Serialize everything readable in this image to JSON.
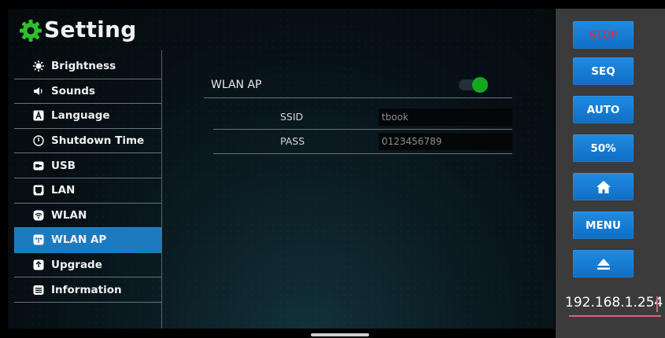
{
  "header": {
    "title": "Setting",
    "icon": "gear-icon",
    "icon_color": "#2fbf2f"
  },
  "sidebar": {
    "items": [
      {
        "label": "Brightness",
        "icon": "brightness-icon"
      },
      {
        "label": "Sounds",
        "icon": "speaker-icon"
      },
      {
        "label": "Language",
        "icon": "language-icon"
      },
      {
        "label": "Shutdown Time",
        "icon": "power-icon"
      },
      {
        "label": "USB",
        "icon": "usb-icon"
      },
      {
        "label": "LAN",
        "icon": "lan-icon"
      },
      {
        "label": "WLAN",
        "icon": "wifi-icon"
      },
      {
        "label": "WLAN AP",
        "icon": "hotspot-icon",
        "active": true
      },
      {
        "label": "Upgrade",
        "icon": "upgrade-icon"
      },
      {
        "label": "Information",
        "icon": "information-icon"
      }
    ],
    "active_color": "#1c7bbf"
  },
  "wlan_ap": {
    "title": "WLAN AP",
    "enabled": true,
    "toggle_color": "#13a81d",
    "ssid_label": "SSID",
    "ssid_value": "tbook",
    "pass_label": "PASS",
    "pass_value": "0123456789"
  },
  "right_panel": {
    "buttons": [
      {
        "label": "STOP",
        "name": "stop-button",
        "color": "#ff2020"
      },
      {
        "label": "SEQ",
        "name": "seq-button"
      },
      {
        "label": "AUTO",
        "name": "auto-button"
      },
      {
        "label": "50%",
        "name": "percent-button"
      },
      {
        "label": "",
        "name": "home-button",
        "icon": "home-icon"
      },
      {
        "label": "MENU",
        "name": "menu-button"
      },
      {
        "label": "",
        "name": "eject-button",
        "icon": "eject-icon"
      }
    ],
    "button_color": "#1a80d6",
    "ip_address": "192.168.1.254"
  }
}
